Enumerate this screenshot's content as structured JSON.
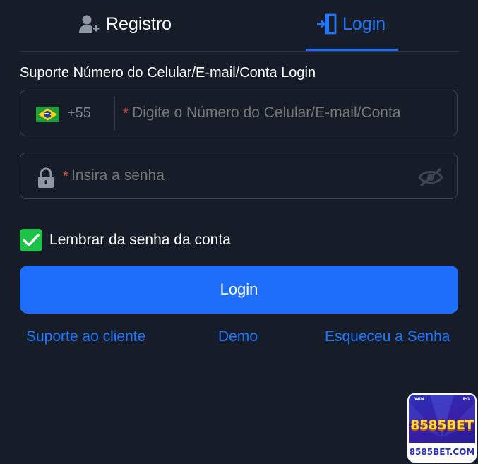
{
  "tabs": {
    "register_label": "Registro",
    "login_label": "Login",
    "active": "login"
  },
  "form": {
    "support_heading": "Suporte Número do Celular/E-mail/Conta Login",
    "country_code": "+55",
    "required_mark": "*",
    "account_placeholder": "Digite o Número do Celular/E-mail/Conta",
    "password_placeholder": "Insira a senha",
    "remember_label": "Lembrar da senha da conta",
    "remember_checked": true,
    "login_button_label": "Login"
  },
  "links": {
    "support": "Suporte ao cliente",
    "demo": "Demo",
    "forgot": "Esqueceu a Senha"
  },
  "badge": {
    "brand": "8585BET",
    "domain": "8585BET.COM",
    "mini_left": "WIN",
    "mini_right": "PG"
  },
  "colors": {
    "background": "#161d29",
    "accent": "#1f6dfb",
    "link": "#1f78ff",
    "check": "#1ec24a",
    "required": "#e5484d"
  },
  "icons": {
    "register": "user-plus-icon",
    "login": "login-door-icon",
    "country": "brazil-flag-icon",
    "password": "lock-icon",
    "visibility": "eye-off-icon",
    "check": "checkmark-icon"
  }
}
